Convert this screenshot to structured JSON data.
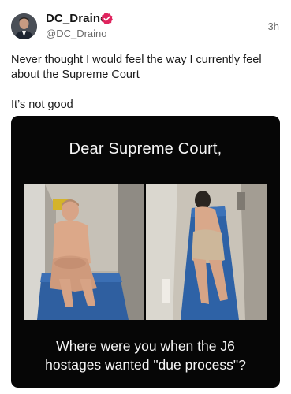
{
  "post": {
    "author": {
      "display_name": "DC_Draino",
      "handle": "@DC_Draino",
      "verified_icon": "verified-badge-icon",
      "badge_color": "#e0245e"
    },
    "timestamp": "3h",
    "text_lines": [
      "Never thought I would feel the way I currently feel about the Supreme Court",
      "It’s not good"
    ],
    "media": {
      "caption_top": "Dear Supreme Court,",
      "caption_bottom_line1": "Where were you when the J6",
      "caption_bottom_line2": "hostages wanted \"due process\"?"
    }
  }
}
